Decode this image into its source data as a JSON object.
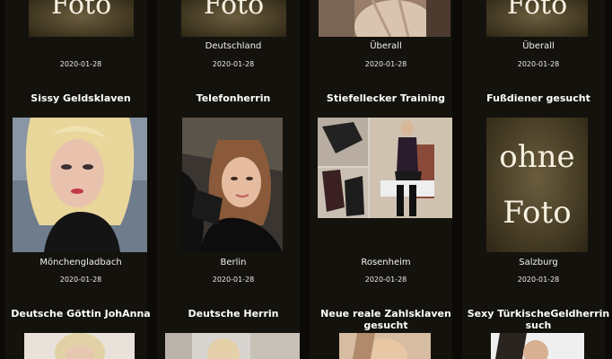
{
  "row1": [
    {
      "location": "",
      "date": "2020-01-28",
      "placeholder": "Foto"
    },
    {
      "location": "Deutschland",
      "date": "2020-01-28",
      "placeholder": "Foto"
    },
    {
      "location": "Überall",
      "date": "2020-01-28"
    },
    {
      "location": "Überall",
      "date": "2020-01-28",
      "placeholder": "Foto"
    }
  ],
  "row2": [
    {
      "title": "Sissy Geldsklaven",
      "location": "Mönchengladbach",
      "date": "2020-01-28"
    },
    {
      "title": "Telefonherrin",
      "location": "Berlin",
      "date": "2020-01-28"
    },
    {
      "title": "Stiefellecker Training",
      "location": "Rosenheim",
      "date": "2020-01-28"
    },
    {
      "title": "Fußdiener gesucht",
      "location": "Salzburg",
      "date": "2020-01-28",
      "placeholder_line1": "ohne",
      "placeholder_line2": "Foto"
    }
  ],
  "row3": [
    {
      "title": "Deutsche Göttin JohAnna"
    },
    {
      "title": "Deutsche Herrin"
    },
    {
      "title": "Neue reale Zahlsklaven gesucht"
    },
    {
      "title": "Sexy TürkischeGeldherrin such"
    }
  ],
  "colors": {
    "background": "#0b0a06",
    "card_column": "#14120c",
    "placeholder": "#4a3f27"
  }
}
